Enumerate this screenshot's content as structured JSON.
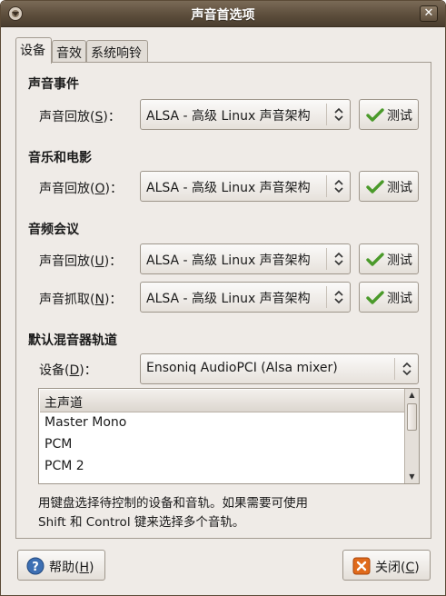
{
  "window": {
    "title": "声音首选项"
  },
  "tabs": [
    {
      "label": "设备",
      "active": true
    },
    {
      "label": "音效",
      "active": false
    },
    {
      "label": "系统响铃",
      "active": false
    }
  ],
  "sections": {
    "sound_events": {
      "title": "声音事件",
      "playback_label": "声音回放(",
      "playback_mnemonic": "S",
      "playback_suffix": ")：",
      "playback_value": "ALSA - 高级 Linux 声音架构",
      "test_label": "测试"
    },
    "music_movies": {
      "title": "音乐和电影",
      "playback_label": "声音回放(",
      "playback_mnemonic": "O",
      "playback_suffix": ")：",
      "playback_value": "ALSA - 高级 Linux 声音架构",
      "test_label": "测试"
    },
    "conferencing": {
      "title": "音频会议",
      "playback_label": "声音回放(",
      "playback_mnemonic": "U",
      "playback_suffix": ")：",
      "playback_value": "ALSA - 高级 Linux 声音架构",
      "playback_test_label": "测试",
      "capture_label": "声音抓取(",
      "capture_mnemonic": "N",
      "capture_suffix": ")：",
      "capture_value": "ALSA - 高级 Linux 声音架构",
      "capture_test_label": "测试"
    },
    "mixer": {
      "title": "默认混音器轨道",
      "device_label": "设备(",
      "device_mnemonic": "D",
      "device_suffix": ")：",
      "device_value": "Ensoniq AudioPCI (Alsa mixer)",
      "tracks": [
        "主声道",
        "Master Mono",
        "PCM",
        "PCM 2"
      ],
      "help_line1": "用键盘选择待控制的设备和音轨。如果需要可使用",
      "help_line2": "Shift 和 Control 键来选择多个音轨。"
    }
  },
  "buttons": {
    "help_label": "帮助(",
    "help_mnemonic": "H",
    "help_suffix": ")",
    "close_label": "关闭(",
    "close_mnemonic": "C",
    "close_suffix": ")"
  },
  "colors": {
    "titlebar": "#5d4e3c",
    "window_bg": "#efebe7",
    "check_green": "#4a9a2a",
    "help_blue": "#3d6fb3",
    "close_orange": "#e06a1b"
  }
}
